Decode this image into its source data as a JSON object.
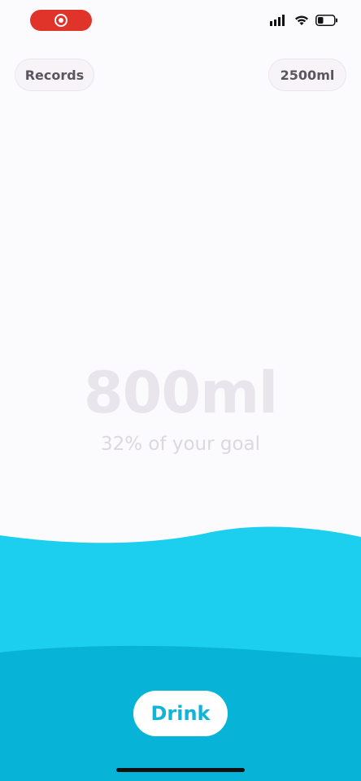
{
  "status_bar": {
    "recording_icon": "screen-recording-icon",
    "signal_icon": "cellular-signal-icon",
    "wifi_icon": "wifi-icon",
    "battery_icon": "battery-icon",
    "battery_level": 0.35,
    "recording_color": "#e0332a"
  },
  "header": {
    "records_label": "Records",
    "goal_label": "2500ml"
  },
  "progress": {
    "amount": "800ml",
    "percent_text": "32% of your goal",
    "fraction": 0.32
  },
  "actions": {
    "drink_label": "Drink"
  },
  "colors": {
    "water_light": "#1dcfef",
    "water_dark": "#07b4d8",
    "accent": "#10b4d6"
  }
}
